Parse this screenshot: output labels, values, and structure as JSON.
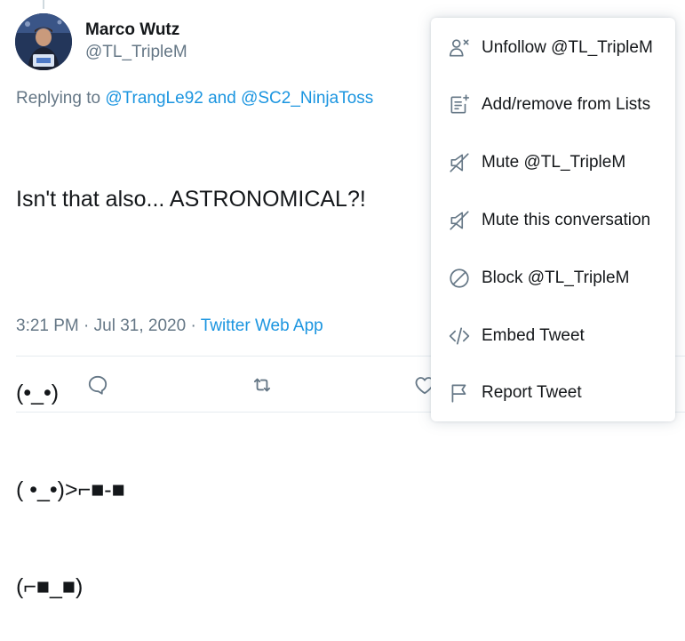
{
  "tweet": {
    "author_name": "Marco Wutz",
    "author_handle": "@TL_TripleM",
    "replying_prefix": "Replying to",
    "mention_1": "@TrangLe92",
    "mention_join": "and",
    "mention_2": "@SC2_NinjaToss",
    "text_lines": [
      "Isn't that also... ASTRONOMICAL?!",
      "",
      "(•_•)",
      "( •_•)>⌐■-■",
      "(⌐■_■)"
    ],
    "time": "3:21 PM",
    "date": "Jul 31, 2020",
    "separator": "·",
    "source": "Twitter Web App"
  },
  "menu": {
    "items": [
      {
        "label": "Unfollow @TL_TripleM",
        "icon": "unfollow-icon"
      },
      {
        "label": "Add/remove from Lists",
        "icon": "list-add-icon"
      },
      {
        "label": "Mute @TL_TripleM",
        "icon": "mute-icon"
      },
      {
        "label": "Mute this conversation",
        "icon": "mute-conversation-icon"
      },
      {
        "label": "Block @TL_TripleM",
        "icon": "block-icon"
      },
      {
        "label": "Embed Tweet",
        "icon": "embed-icon"
      },
      {
        "label": "Report Tweet",
        "icon": "flag-icon"
      }
    ]
  },
  "colors": {
    "link": "#1b95e0",
    "secondary_text": "#657786",
    "icon": "#657786",
    "primary_text": "#14171a"
  }
}
